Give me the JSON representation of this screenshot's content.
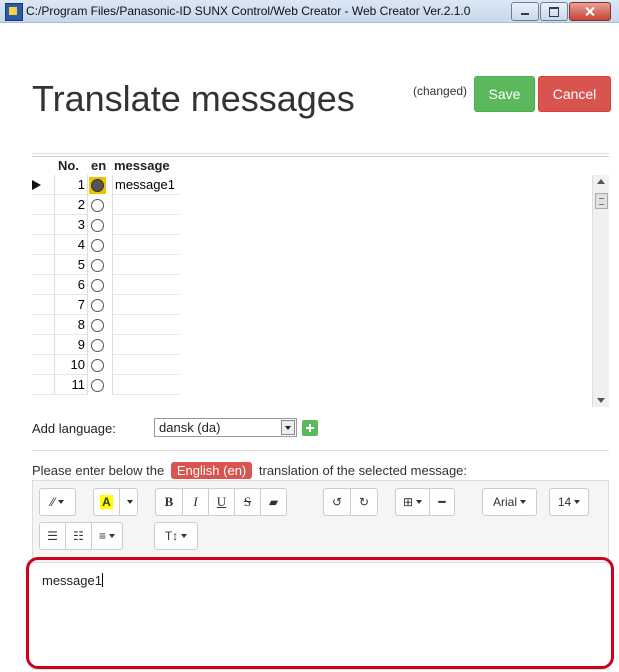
{
  "window": {
    "title": "C:/Program Files/Panasonic-ID SUNX Control/Web Creator - Web Creator Ver.2.1.0"
  },
  "header": {
    "title": "Translate messages",
    "status": "(changed)",
    "save_label": "Save",
    "cancel_label": "Cancel"
  },
  "table": {
    "columns": [
      "No.",
      "en",
      "message"
    ],
    "rows": [
      {
        "no": "1",
        "message": "message1",
        "selected": true
      },
      {
        "no": "2",
        "message": ""
      },
      {
        "no": "3",
        "message": ""
      },
      {
        "no": "4",
        "message": ""
      },
      {
        "no": "5",
        "message": ""
      },
      {
        "no": "6",
        "message": ""
      },
      {
        "no": "7",
        "message": ""
      },
      {
        "no": "8",
        "message": ""
      },
      {
        "no": "9",
        "message": ""
      },
      {
        "no": "10",
        "message": ""
      },
      {
        "no": "11",
        "message": ""
      }
    ]
  },
  "add_language": {
    "label": "Add language:",
    "selected": "dansk (da)"
  },
  "instruction": {
    "before": "Please enter below the",
    "language": "English (en)",
    "after": "translation of the selected message:"
  },
  "toolbar": {
    "font_name": "Arial",
    "font_size": "14",
    "bold": "B",
    "italic": "I",
    "underline": "U",
    "strike": "S",
    "highlight": "A",
    "text_height": "T↕"
  },
  "editor": {
    "content": "message1"
  },
  "colors": {
    "save": "#5cb85c",
    "cancel": "#d9534f",
    "selected_radio": "#f2c200",
    "focus_ring": "#d0021b"
  }
}
